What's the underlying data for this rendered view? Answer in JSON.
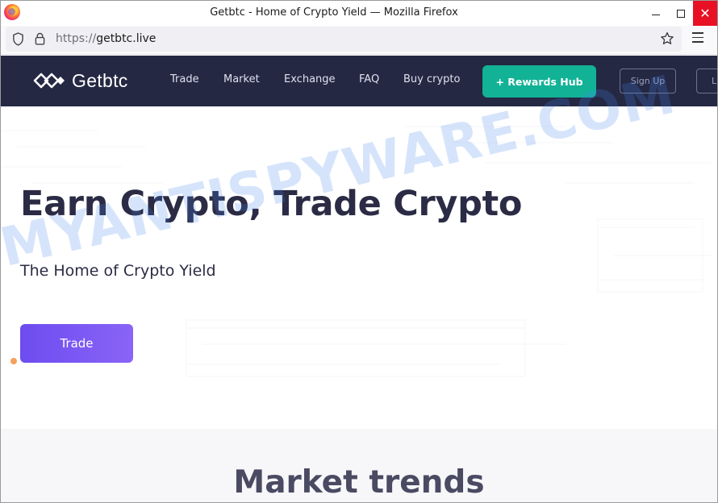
{
  "browser": {
    "window_title": "Getbtc - Home of Crypto Yield — Mozilla Firefox",
    "url_scheme": "https://",
    "url_host": "getbtc.live",
    "close_glyph": "✕"
  },
  "site": {
    "brand": "Getbtc",
    "nav": [
      "Trade",
      "Market",
      "Exchange",
      "FAQ",
      "Buy crypto"
    ],
    "rewards_button": "+ Rewards Hub",
    "signup_button": "Sign Up",
    "login_button": "L"
  },
  "hero": {
    "title": "Earn Crypto, Trade Crypto",
    "subtitle": "The Home of Crypto Yield",
    "cta": "Trade"
  },
  "market": {
    "title": "Market trends"
  },
  "watermark": "MYANTISPYWARE.COM",
  "colors": {
    "header_bg": "#242843",
    "rewards_green": "#12b296",
    "cta_purple": "#7355f3",
    "title_text": "#2b2b45"
  }
}
